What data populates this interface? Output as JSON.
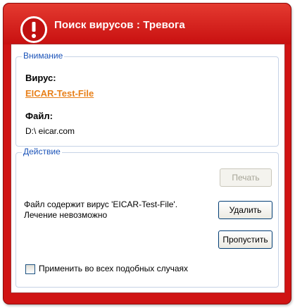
{
  "window": {
    "title": "Поиск вирусов : Тревога",
    "icon": "alert-exclamation-icon",
    "accent_color": "#d01414"
  },
  "warning_group": {
    "legend": "Внимание",
    "virus_label": "Вирус:",
    "virus_name": "EICAR-Test-File",
    "file_label": "Файл:",
    "file_path": "D:\\ eicar.com"
  },
  "action_group": {
    "legend": "Действие",
    "message": "Файл содержит вирус 'EICAR-Test-File'. Лечение невозможно",
    "print_label": "Печать",
    "delete_label": "Удалить",
    "skip_label": "Пропустить",
    "apply_all_label": "Применить во всех подобных случаях",
    "apply_all_checked": false
  }
}
